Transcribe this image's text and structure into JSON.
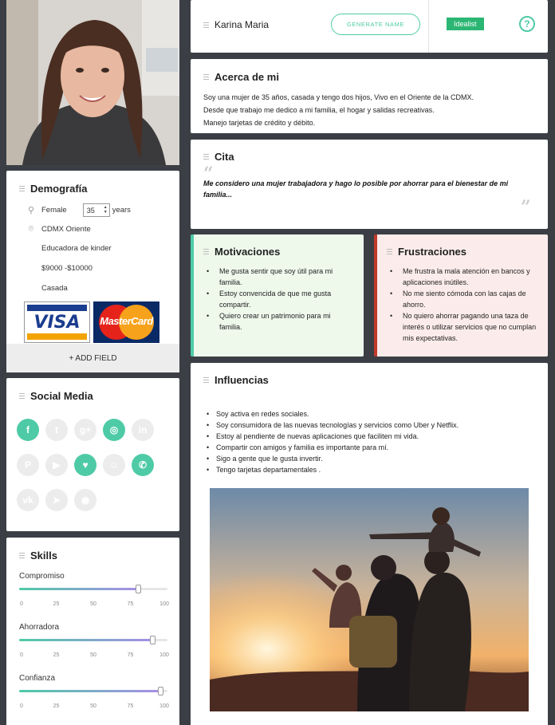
{
  "persona": {
    "name": "Karina Maria",
    "generate_label": "GENERATE NAME",
    "badge": "Idealist",
    "help": "?"
  },
  "demographics": {
    "title": "Demografía",
    "gender": "Female",
    "age": "35",
    "age_unit": "years",
    "location": "CDMX Oriente",
    "occupation": "Educadora de kinder",
    "income": "$9000 -$10000",
    "status": "Casada",
    "visa": "VISA",
    "mastercard": "MasterCard",
    "add_field": "+ ADD FIELD"
  },
  "social": {
    "title": "Social Media",
    "icons": [
      {
        "name": "facebook-icon",
        "glyph": "f",
        "active": true
      },
      {
        "name": "twitter-icon",
        "glyph": "t",
        "active": false
      },
      {
        "name": "google-plus-icon",
        "glyph": "g+",
        "active": false
      },
      {
        "name": "instagram-icon",
        "glyph": "◎",
        "active": true
      },
      {
        "name": "linkedin-icon",
        "glyph": "in",
        "active": false
      },
      {
        "name": "pinterest-icon",
        "glyph": "P",
        "active": false
      },
      {
        "name": "youtube-icon",
        "glyph": "▶",
        "active": false
      },
      {
        "name": "foursquare-icon",
        "glyph": "♥",
        "active": true
      },
      {
        "name": "snapchat-icon",
        "glyph": "☺",
        "active": false
      },
      {
        "name": "whatsapp-icon",
        "glyph": "✆",
        "active": true
      },
      {
        "name": "vk-icon",
        "glyph": "vk",
        "active": false
      },
      {
        "name": "telegram-icon",
        "glyph": "➤",
        "active": false
      },
      {
        "name": "reddit-icon",
        "glyph": "◉",
        "active": false
      }
    ]
  },
  "skills": {
    "title": "Skills",
    "ticks": [
      "0",
      "25",
      "50",
      "75",
      "100"
    ],
    "items": [
      {
        "label": "Compromiso",
        "value": 80
      },
      {
        "label": "Ahorradora",
        "value": 90
      },
      {
        "label": "Confianza",
        "value": 95
      }
    ]
  },
  "about": {
    "title": "Acerca de mi",
    "lines": [
      "Soy una mujer de 35 años, casada y tengo dos hijos, Vivo en el Oriente de la CDMX.",
      "Desde que trabajo me dedico a mi familia, el hogar y salidas recreativas.",
      "Manejo tarjetas de crédito y débito."
    ]
  },
  "quote": {
    "title": "Cita",
    "text": "Me considero una mujer trabajadora  y hago lo posible por ahorrar para el bienestar de mi familia..."
  },
  "motivations": {
    "title": "Motivaciones",
    "items": [
      "Me gusta sentir que soy útil para mi familia.",
      "Estoy convencida de que me gusta compartir.",
      "Quiero crear un patrimonio para mi familia."
    ]
  },
  "frustrations": {
    "title": "Frustraciones",
    "items": [
      "Me frustra la mala atención en bancos y aplicaciones inútiles.",
      "No me siento cómoda con las cajas de ahorro.",
      "No quiero ahorrar pagando una taza de interés o utilizar servicios que no cumplan mis expectativas."
    ]
  },
  "influences": {
    "title": "Influencias",
    "items": [
      "Soy activa en redes sociales.",
      "Soy consumidora de las nuevas tecnologías y servicios como Uber y Netflix.",
      "Estoy al pendiente de nuevas aplicaciones que faciliten mi vida.",
      "Compartir con amigos y familia es importante para mí.",
      "Sigo a gente que le gusta invertir.",
      "Tengo tarjetas departamentales ."
    ]
  },
  "colors": {
    "accent": "#4ecba6",
    "badge": "#2bb673",
    "frustration": "#c13b2a"
  }
}
